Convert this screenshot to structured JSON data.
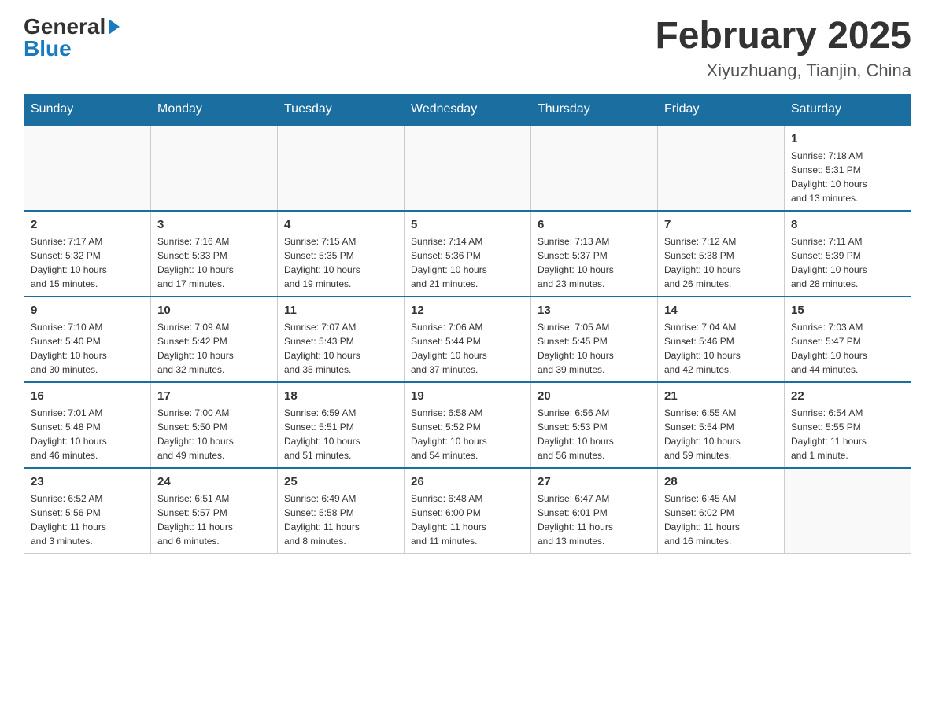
{
  "header": {
    "logo_general": "General",
    "logo_blue": "Blue",
    "month_title": "February 2025",
    "location": "Xiyuzhuang, Tianjin, China"
  },
  "weekdays": [
    "Sunday",
    "Monday",
    "Tuesday",
    "Wednesday",
    "Thursday",
    "Friday",
    "Saturday"
  ],
  "weeks": [
    [
      {
        "day": "",
        "info": ""
      },
      {
        "day": "",
        "info": ""
      },
      {
        "day": "",
        "info": ""
      },
      {
        "day": "",
        "info": ""
      },
      {
        "day": "",
        "info": ""
      },
      {
        "day": "",
        "info": ""
      },
      {
        "day": "1",
        "info": "Sunrise: 7:18 AM\nSunset: 5:31 PM\nDaylight: 10 hours\nand 13 minutes."
      }
    ],
    [
      {
        "day": "2",
        "info": "Sunrise: 7:17 AM\nSunset: 5:32 PM\nDaylight: 10 hours\nand 15 minutes."
      },
      {
        "day": "3",
        "info": "Sunrise: 7:16 AM\nSunset: 5:33 PM\nDaylight: 10 hours\nand 17 minutes."
      },
      {
        "day": "4",
        "info": "Sunrise: 7:15 AM\nSunset: 5:35 PM\nDaylight: 10 hours\nand 19 minutes."
      },
      {
        "day": "5",
        "info": "Sunrise: 7:14 AM\nSunset: 5:36 PM\nDaylight: 10 hours\nand 21 minutes."
      },
      {
        "day": "6",
        "info": "Sunrise: 7:13 AM\nSunset: 5:37 PM\nDaylight: 10 hours\nand 23 minutes."
      },
      {
        "day": "7",
        "info": "Sunrise: 7:12 AM\nSunset: 5:38 PM\nDaylight: 10 hours\nand 26 minutes."
      },
      {
        "day": "8",
        "info": "Sunrise: 7:11 AM\nSunset: 5:39 PM\nDaylight: 10 hours\nand 28 minutes."
      }
    ],
    [
      {
        "day": "9",
        "info": "Sunrise: 7:10 AM\nSunset: 5:40 PM\nDaylight: 10 hours\nand 30 minutes."
      },
      {
        "day": "10",
        "info": "Sunrise: 7:09 AM\nSunset: 5:42 PM\nDaylight: 10 hours\nand 32 minutes."
      },
      {
        "day": "11",
        "info": "Sunrise: 7:07 AM\nSunset: 5:43 PM\nDaylight: 10 hours\nand 35 minutes."
      },
      {
        "day": "12",
        "info": "Sunrise: 7:06 AM\nSunset: 5:44 PM\nDaylight: 10 hours\nand 37 minutes."
      },
      {
        "day": "13",
        "info": "Sunrise: 7:05 AM\nSunset: 5:45 PM\nDaylight: 10 hours\nand 39 minutes."
      },
      {
        "day": "14",
        "info": "Sunrise: 7:04 AM\nSunset: 5:46 PM\nDaylight: 10 hours\nand 42 minutes."
      },
      {
        "day": "15",
        "info": "Sunrise: 7:03 AM\nSunset: 5:47 PM\nDaylight: 10 hours\nand 44 minutes."
      }
    ],
    [
      {
        "day": "16",
        "info": "Sunrise: 7:01 AM\nSunset: 5:48 PM\nDaylight: 10 hours\nand 46 minutes."
      },
      {
        "day": "17",
        "info": "Sunrise: 7:00 AM\nSunset: 5:50 PM\nDaylight: 10 hours\nand 49 minutes."
      },
      {
        "day": "18",
        "info": "Sunrise: 6:59 AM\nSunset: 5:51 PM\nDaylight: 10 hours\nand 51 minutes."
      },
      {
        "day": "19",
        "info": "Sunrise: 6:58 AM\nSunset: 5:52 PM\nDaylight: 10 hours\nand 54 minutes."
      },
      {
        "day": "20",
        "info": "Sunrise: 6:56 AM\nSunset: 5:53 PM\nDaylight: 10 hours\nand 56 minutes."
      },
      {
        "day": "21",
        "info": "Sunrise: 6:55 AM\nSunset: 5:54 PM\nDaylight: 10 hours\nand 59 minutes."
      },
      {
        "day": "22",
        "info": "Sunrise: 6:54 AM\nSunset: 5:55 PM\nDaylight: 11 hours\nand 1 minute."
      }
    ],
    [
      {
        "day": "23",
        "info": "Sunrise: 6:52 AM\nSunset: 5:56 PM\nDaylight: 11 hours\nand 3 minutes."
      },
      {
        "day": "24",
        "info": "Sunrise: 6:51 AM\nSunset: 5:57 PM\nDaylight: 11 hours\nand 6 minutes."
      },
      {
        "day": "25",
        "info": "Sunrise: 6:49 AM\nSunset: 5:58 PM\nDaylight: 11 hours\nand 8 minutes."
      },
      {
        "day": "26",
        "info": "Sunrise: 6:48 AM\nSunset: 6:00 PM\nDaylight: 11 hours\nand 11 minutes."
      },
      {
        "day": "27",
        "info": "Sunrise: 6:47 AM\nSunset: 6:01 PM\nDaylight: 11 hours\nand 13 minutes."
      },
      {
        "day": "28",
        "info": "Sunrise: 6:45 AM\nSunset: 6:02 PM\nDaylight: 11 hours\nand 16 minutes."
      },
      {
        "day": "",
        "info": ""
      }
    ]
  ]
}
